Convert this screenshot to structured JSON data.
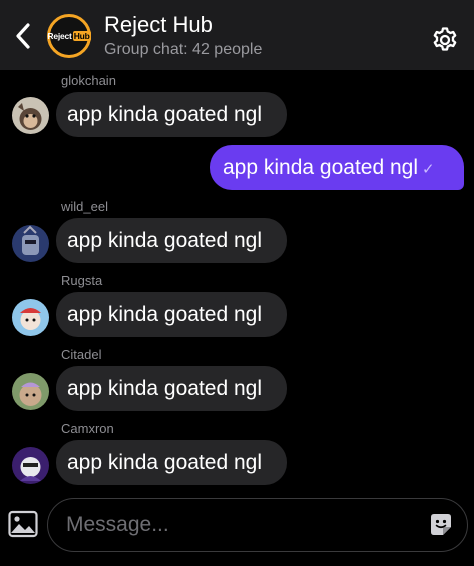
{
  "header": {
    "title": "Reject Hub",
    "subtitle": "Group chat: 42 people",
    "logo_text_1": "Reject",
    "logo_text_2": "Hub"
  },
  "messages": [
    {
      "sender": "glokchain",
      "text": "app kinda goated ngl",
      "avatar": "monkey-avatar"
    },
    {
      "sender": "",
      "text": "app kinda goated ngl",
      "outgoing": true,
      "status": "✓"
    },
    {
      "sender": "wild_eel",
      "text": "app kinda goated ngl",
      "avatar": "robot-avatar"
    },
    {
      "sender": "Rugsta",
      "text": "app kinda goated ngl",
      "avatar": "cartoon-avatar"
    },
    {
      "sender": "Citadel",
      "text": "app kinda goated ngl",
      "avatar": "ape-avatar"
    },
    {
      "sender": "Camxron",
      "text": "app kinda goated ngl",
      "avatar": "purple-avatar"
    }
  ],
  "composer": {
    "placeholder": "Message..."
  },
  "colors": {
    "accent": "#6a3cf0",
    "bubble_in": "#262628",
    "logo_ring": "#f5a524"
  },
  "icons": {
    "back": "chevron-left-icon",
    "settings": "gear-icon",
    "photo": "image-icon",
    "sticker": "sticker-icon"
  }
}
